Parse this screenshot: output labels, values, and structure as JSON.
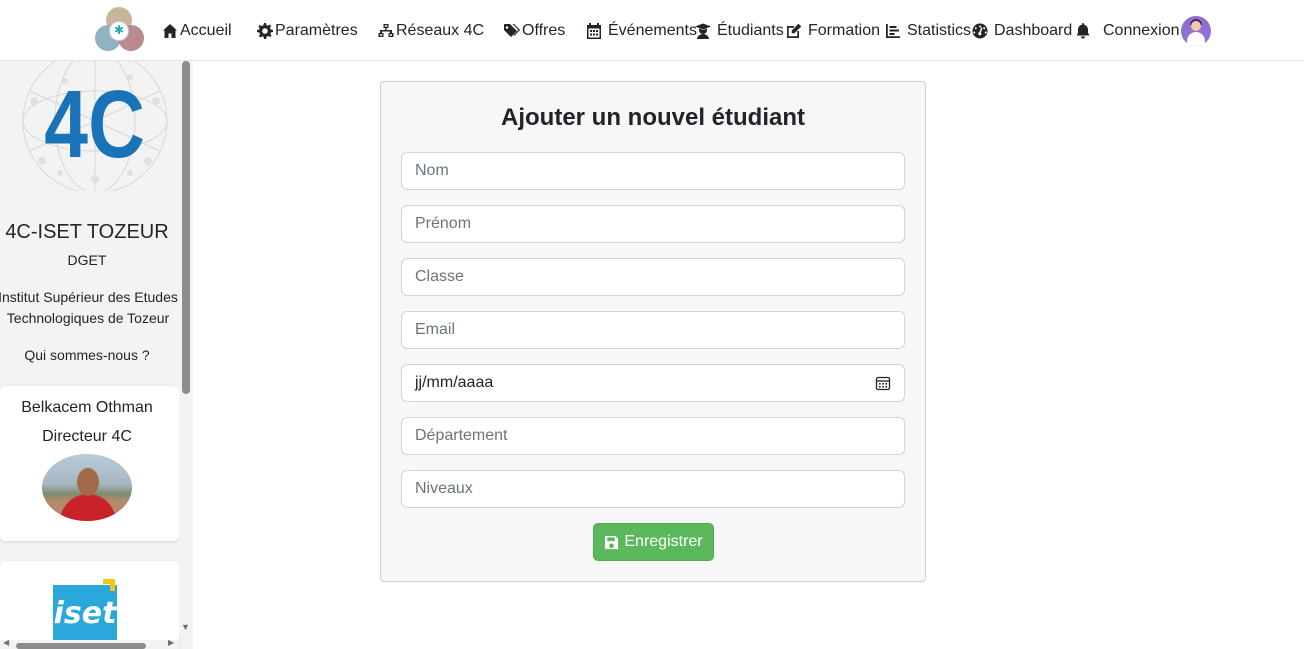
{
  "nav": {
    "items": [
      {
        "label": "Accueil",
        "icon": "home-icon"
      },
      {
        "label": "Paramètres",
        "icon": "gear-icon"
      },
      {
        "label": "Réseaux 4C",
        "icon": "network-icon"
      },
      {
        "label": "Offres",
        "icon": "tags-icon"
      },
      {
        "label": "Événements",
        "icon": "calendar-icon"
      },
      {
        "label": "Étudiants",
        "icon": "graduate-icon"
      },
      {
        "label": "Formation",
        "icon": "edit-icon"
      },
      {
        "label": "Statistics",
        "icon": "chart-icon"
      },
      {
        "label": "Dashboard",
        "icon": "gauge-icon"
      },
      {
        "label": "Connexion",
        "icon": "bell-icon"
      }
    ]
  },
  "sidebar": {
    "logo_text": "4C",
    "title": "4C-ISET TOZEUR",
    "subtitle": "DGET",
    "description_line1": "Institut Supérieur des Etudes",
    "description_line2": "Technologiques de Tozeur",
    "about_link": "Qui sommes-nous ?",
    "director": {
      "name": "Belkacem Othman",
      "role": "Directeur 4C"
    },
    "partner_logo_text": "iset"
  },
  "form": {
    "title": "Ajouter un nouvel étudiant",
    "fields": {
      "nom": "Nom",
      "prenom": "Prénom",
      "classe": "Classe",
      "email": "Email",
      "date": "jj/mm/aaaa",
      "departement": "Département",
      "niveaux": "Niveaux"
    },
    "save_label": "Enregistrer"
  },
  "colors": {
    "save_button": "#5cb85c",
    "logo_blue": "#1a73b8"
  }
}
